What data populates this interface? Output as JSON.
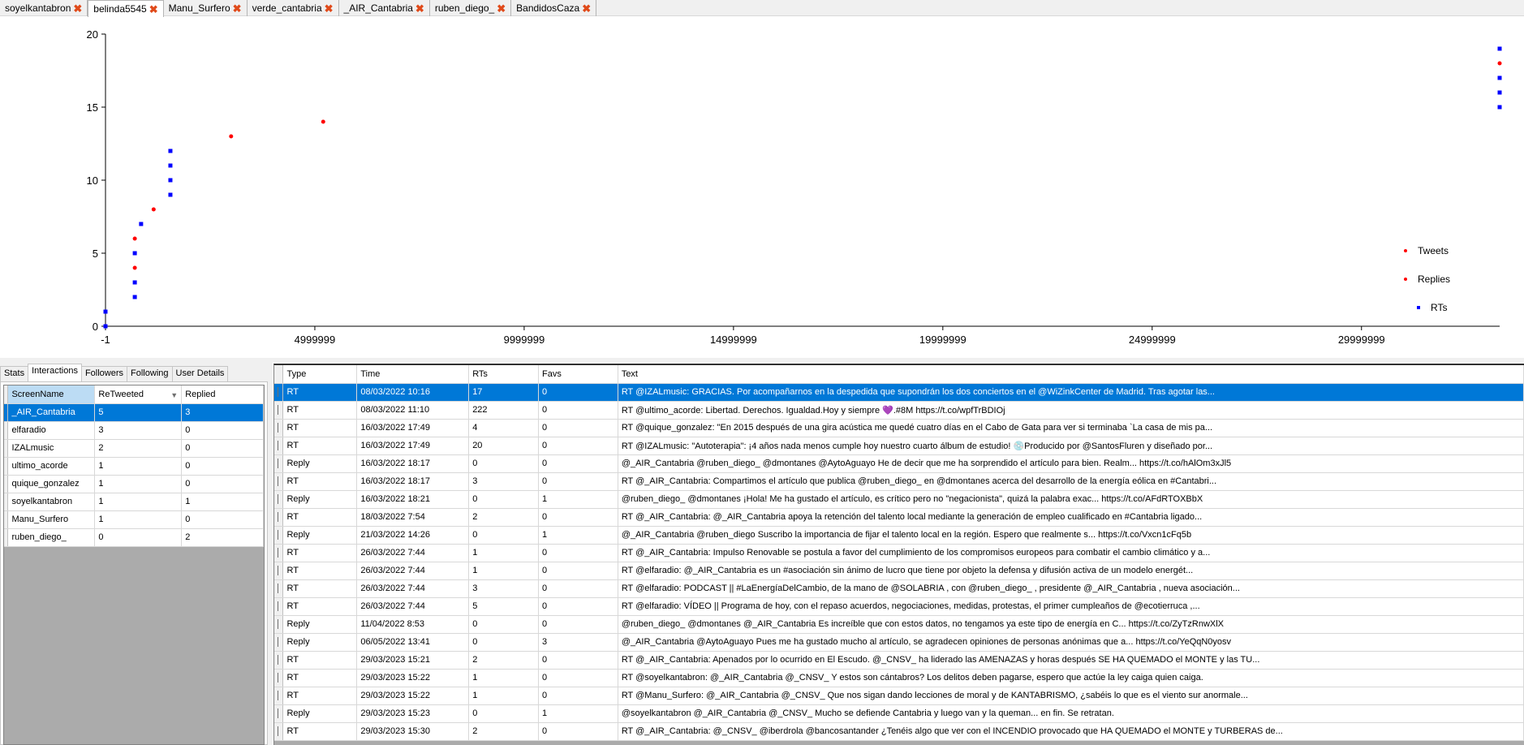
{
  "user_tabs": [
    {
      "label": "soyelkantabron",
      "active": false
    },
    {
      "label": "belinda5545",
      "active": true
    },
    {
      "label": "Manu_Surfero",
      "active": false
    },
    {
      "label": "verde_cantabria",
      "active": false
    },
    {
      "label": "_AIR_Cantabria",
      "active": false
    },
    {
      "label": "ruben_diego_",
      "active": false
    },
    {
      "label": "BandidosCaza",
      "active": false
    }
  ],
  "close_glyph": "✖",
  "chart_data": {
    "type": "scatter",
    "x_ticks": [
      "-1",
      "4999999",
      "9999999",
      "14999999",
      "19999999",
      "24999999",
      "29999999"
    ],
    "y_ticks": [
      "0",
      "5",
      "10",
      "15",
      "20"
    ],
    "xlim": [
      -1,
      33300000
    ],
    "ylim": [
      0,
      20
    ],
    "series": [
      {
        "name": "Tweets",
        "color": "#ff0000",
        "marker": "dot",
        "points": []
      },
      {
        "name": "Replies",
        "color": "#ff0000",
        "marker": "dot",
        "points": [
          [
            0,
            0
          ],
          [
            700000,
            4
          ],
          [
            700000,
            6
          ],
          [
            1150000,
            8
          ],
          [
            3000000,
            13
          ],
          [
            5200000,
            14
          ]
        ]
      },
      {
        "name": "RTs",
        "color": "#0000ff",
        "marker": "square",
        "points": [
          [
            0,
            0
          ],
          [
            0,
            1
          ],
          [
            700000,
            2
          ],
          [
            700000,
            3
          ],
          [
            700000,
            5
          ],
          [
            850000,
            7
          ],
          [
            1550000,
            9
          ],
          [
            1550000,
            10
          ],
          [
            1550000,
            11
          ],
          [
            1550000,
            12
          ]
        ]
      }
    ],
    "legend": "right"
  },
  "panel_tabs": [
    {
      "label": "Stats",
      "active": false
    },
    {
      "label": "Interactions",
      "active": true
    },
    {
      "label": "Followers",
      "active": false
    },
    {
      "label": "Following",
      "active": false
    },
    {
      "label": "User Details",
      "active": false
    }
  ],
  "interactions": {
    "columns": [
      "ScreenName",
      "ReTweeted",
      "Replied"
    ],
    "rows": [
      [
        "_AIR_Cantabria",
        "5",
        "3"
      ],
      [
        "elfaradio",
        "3",
        "0"
      ],
      [
        "IZALmusic",
        "2",
        "0"
      ],
      [
        "ultimo_acorde",
        "1",
        "0"
      ],
      [
        "quique_gonzalez",
        "1",
        "0"
      ],
      [
        "soyelkantabron",
        "1",
        "1"
      ],
      [
        "Manu_Surfero",
        "1",
        "0"
      ],
      [
        "ruben_diego_",
        "0",
        "2"
      ]
    ]
  },
  "tweets": {
    "columns": [
      "Type",
      "Time",
      "RTs",
      "Favs",
      "Text"
    ],
    "rows": [
      [
        "RT",
        "08/03/2022 10:16",
        "17",
        "0",
        "RT @IZALmusic: GRACIAS. Por acompañarnos en la despedida que supondrán los dos conciertos en el @WiZinkCenter de Madrid. Tras agotar las..."
      ],
      [
        "RT",
        "08/03/2022 11:10",
        "222",
        "0",
        "RT @ultimo_acorde: Libertad. Derechos. Igualdad.Hoy y siempre 💜.#8M https://t.co/wpfTrBDIOj"
      ],
      [
        "RT",
        "16/03/2022 17:49",
        "4",
        "0",
        "RT @quique_gonzalez: \"En 2015 después de una gira acústica me quedé cuatro días en el Cabo de Gata para ver si terminaba `La casa de mis pa..."
      ],
      [
        "RT",
        "16/03/2022 17:49",
        "20",
        "0",
        "RT @IZALmusic: \"Autoterapia\": ¡4 años nada menos cumple hoy nuestro cuarto álbum de estudio! 💿Producido por @SantosFluren y diseñado por..."
      ],
      [
        "Reply",
        "16/03/2022 18:17",
        "0",
        "0",
        "@_AIR_Cantabria @ruben_diego_ @dmontanes @AytoAguayo He de decir que me ha sorprendido el artículo para bien. Realm... https://t.co/hAlOm3xJl5"
      ],
      [
        "RT",
        "16/03/2022 18:17",
        "3",
        "0",
        "RT @_AIR_Cantabria: Compartimos el artículo que publica @ruben_diego_ en @dmontanes acerca del desarrollo de la energía eólica en #Cantabri..."
      ],
      [
        "Reply",
        "16/03/2022 18:21",
        "0",
        "1",
        "@ruben_diego_ @dmontanes ¡Hola! Me ha gustado el artículo, es crítico pero no \"negacionista\", quizá la palabra exac... https://t.co/AFdRTOXBbX"
      ],
      [
        "RT",
        "18/03/2022 7:54",
        "2",
        "0",
        "RT @_AIR_Cantabria: @_AIR_Cantabria apoya la retención del talento local mediante la generación de empleo cualificado en #Cantabria ligado..."
      ],
      [
        "Reply",
        "21/03/2022 14:26",
        "0",
        "1",
        "@_AIR_Cantabria @ruben_diego Suscribo la importancia de fijar el talento local en la región. Espero que realmente s... https://t.co/Vxcn1cFq5b"
      ],
      [
        "RT",
        "26/03/2022 7:44",
        "1",
        "0",
        "RT @_AIR_Cantabria: Impulso Renovable se postula a favor del cumplimiento de los compromisos europeos para combatir el cambio climático y a..."
      ],
      [
        "RT",
        "26/03/2022 7:44",
        "1",
        "0",
        "RT @elfaradio: @_AIR_Cantabria es un #asociación sin ánimo de lucro que tiene por objeto la defensa y difusión activa de un modelo energét..."
      ],
      [
        "RT",
        "26/03/2022 7:44",
        "3",
        "0",
        "RT @elfaradio: PODCAST || #LaEnergíaDelCambio, de la mano de @SOLABRIA , con @ruben_diego_ , presidente @_AIR_Cantabria , nueva asociación..."
      ],
      [
        "RT",
        "26/03/2022 7:44",
        "5",
        "0",
        "RT @elfaradio: VÍDEO || Programa de hoy, con el repaso acuerdos, negociaciones, medidas, protestas, el primer cumpleaños de @ecotierruca ,..."
      ],
      [
        "Reply",
        "11/04/2022 8:53",
        "0",
        "0",
        "@ruben_diego_ @dmontanes @_AIR_Cantabria Es increíble que con estos datos, no tengamos ya este tipo de energía en C... https://t.co/ZyTzRnwXlX"
      ],
      [
        "Reply",
        "06/05/2022 13:41",
        "0",
        "3",
        "@_AIR_Cantabria @AytoAguayo Pues me ha gustado mucho al artículo, se agradecen opiniones de personas anónimas que a... https://t.co/YeQqN0yosv"
      ],
      [
        "RT",
        "29/03/2023 15:21",
        "2",
        "0",
        "RT @_AIR_Cantabria: Apenados por lo ocurrido en El Escudo. @_CNSV_ ha liderado las AMENAZAS y horas después SE HA QUEMADO el MONTE y las TU..."
      ],
      [
        "RT",
        "29/03/2023 15:22",
        "1",
        "0",
        "RT @soyelkantabron: @_AIR_Cantabria @_CNSV_ Y estos son cántabros? Los delitos deben pagarse, espero que actúe la ley caiga quien caiga."
      ],
      [
        "RT",
        "29/03/2023 15:22",
        "1",
        "0",
        "RT @Manu_Surfero: @_AIR_Cantabria @_CNSV_ Que nos sigan dando lecciones de moral y de KANTABRISMO, ¿sabéis lo que es el viento sur anormale..."
      ],
      [
        "Reply",
        "29/03/2023 15:23",
        "0",
        "1",
        "@soyelkantabron @_AIR_Cantabria @_CNSV_ Mucho se defiende Cantabria y luego van y la queman... en fin. Se retratan."
      ],
      [
        "RT",
        "29/03/2023 15:30",
        "2",
        "0",
        "RT @_AIR_Cantabria: @_CNSV_ @iberdrola @bancosantander ¿Tenéis algo que ver con el INCENDIO provocado que HA QUEMADO el MONTE y TURBERAS de..."
      ]
    ]
  }
}
